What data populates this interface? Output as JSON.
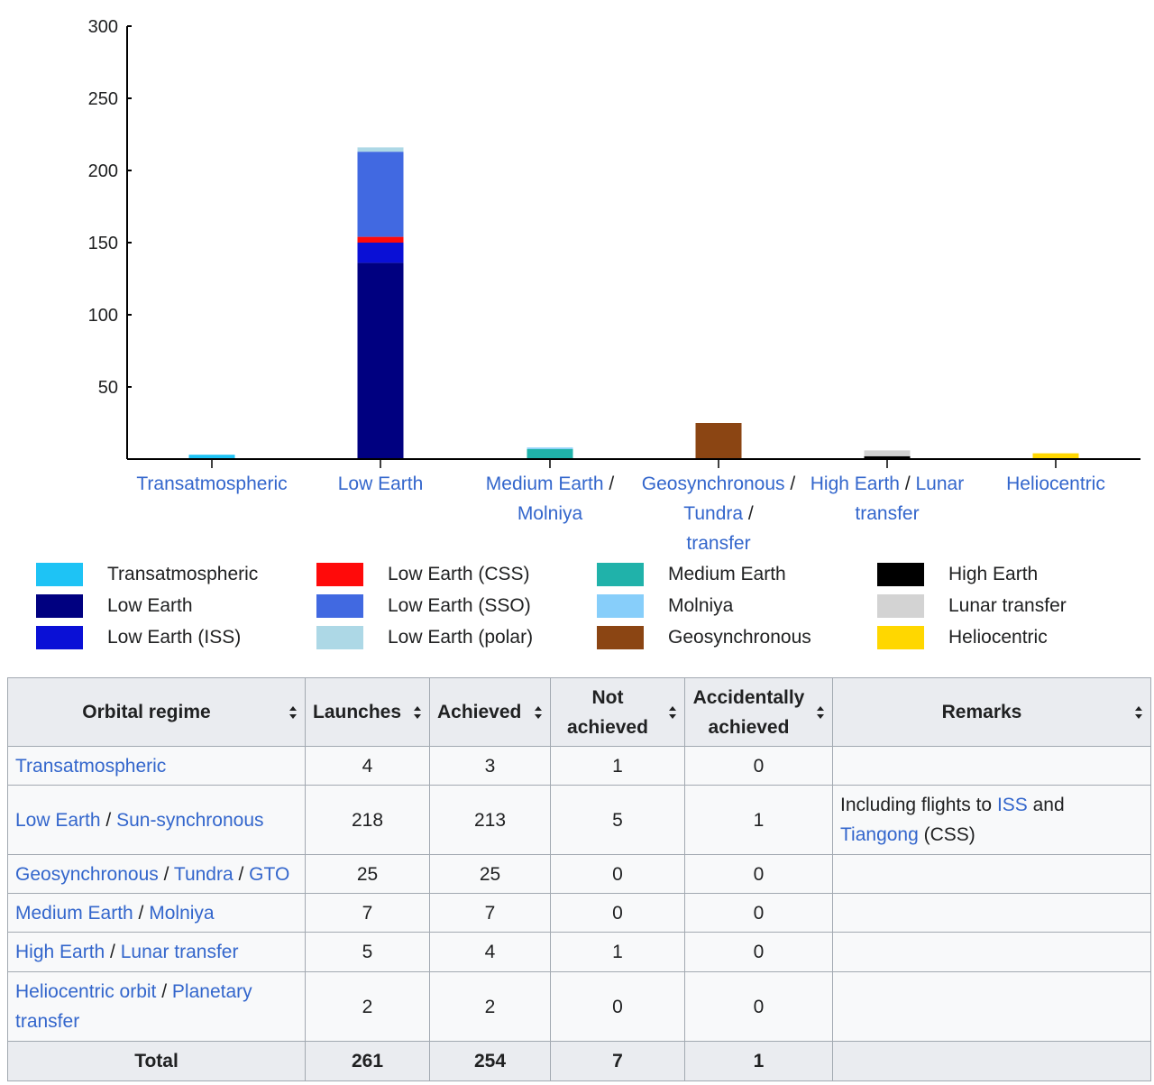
{
  "chart_data": {
    "type": "bar",
    "stacked": true,
    "yticks": [
      50,
      100,
      150,
      200,
      250,
      300
    ],
    "ylim": [
      0,
      300
    ],
    "grid": false,
    "legend_placement": "bottom",
    "categories": [
      [
        {
          "text": "Transatmospheric",
          "link": true
        }
      ],
      [
        {
          "text": "Low Earth",
          "link": true
        }
      ],
      [
        {
          "text": "Medium Earth",
          "link": true
        },
        {
          "text": " /",
          "link": false
        },
        {
          "text": "Molniya",
          "link": true
        }
      ],
      [
        {
          "text": "Geosynchronous",
          "link": true
        },
        {
          "text": " /",
          "link": false
        },
        {
          "text": "Tundra",
          "link": true
        },
        {
          "text": " / ",
          "link": false
        },
        {
          "text": "transfer",
          "link": true
        }
      ],
      [
        {
          "text": "High Earth",
          "link": true
        },
        {
          "text": " / ",
          "link": false
        },
        {
          "text": "Lunar",
          "link": true
        },
        {
          "text": "transfer",
          "link": true
        }
      ],
      [
        {
          "text": "Heliocentric",
          "link": true
        }
      ]
    ],
    "series": [
      {
        "name": "Transatmospheric",
        "color": "#1ec3f5",
        "values": [
          3,
          0,
          0,
          0,
          0,
          0
        ]
      },
      {
        "name": "Low Earth",
        "color": "#000080",
        "values": [
          0,
          136,
          0,
          0,
          0,
          0
        ]
      },
      {
        "name": "Low Earth (ISS)",
        "color": "#0a10d6",
        "values": [
          0,
          14,
          0,
          0,
          0,
          0
        ]
      },
      {
        "name": "Low Earth (CSS)",
        "color": "#ff0a0a",
        "values": [
          0,
          4,
          0,
          0,
          0,
          0
        ]
      },
      {
        "name": "Low Earth (SSO)",
        "color": "#4169e1",
        "values": [
          0,
          59,
          0,
          0,
          0,
          0
        ]
      },
      {
        "name": "Low Earth (polar)",
        "color": "#add8e6",
        "values": [
          0,
          3,
          0,
          0,
          0,
          0
        ]
      },
      {
        "name": "Medium Earth",
        "color": "#20b2aa",
        "values": [
          0,
          0,
          7,
          0,
          0,
          0
        ]
      },
      {
        "name": "Molniya",
        "color": "#87cefa",
        "values": [
          0,
          0,
          1,
          0,
          0,
          0
        ]
      },
      {
        "name": "Geosynchronous",
        "color": "#8b4513",
        "values": [
          0,
          0,
          0,
          25,
          0,
          0
        ]
      },
      {
        "name": "High Earth",
        "color": "#000000",
        "values": [
          0,
          0,
          0,
          0,
          2,
          0
        ]
      },
      {
        "name": "Lunar transfer",
        "color": "#d3d3d3",
        "values": [
          0,
          0,
          0,
          0,
          4,
          0
        ]
      },
      {
        "name": "Heliocentric",
        "color": "#ffd700",
        "values": [
          0,
          0,
          0,
          0,
          0,
          4
        ]
      }
    ]
  },
  "legend": [
    [
      "Transatmospheric",
      "Low Earth",
      "Low Earth (ISS)"
    ],
    [
      "Low Earth (CSS)",
      "Low Earth (SSO)",
      "Low Earth (polar)"
    ],
    [
      "Medium Earth",
      "Molniya",
      "Geosynchronous"
    ],
    [
      "High Earth",
      "Lunar transfer",
      "Heliocentric"
    ]
  ],
  "table": {
    "headers": {
      "orbital_regime": "Orbital regime",
      "launches": "Launches",
      "achieved": "Achieved",
      "not_achieved": "Not achieved",
      "accidentally_achieved": "Accidentally achieved",
      "remarks": "Remarks"
    },
    "rows": [
      {
        "regime": [
          {
            "text": "Transatmospheric",
            "link": true
          }
        ],
        "launches": "4",
        "achieved": "3",
        "not_achieved": "1",
        "accidentally": "0",
        "remarks": []
      },
      {
        "regime": [
          {
            "text": "Low Earth",
            "link": true
          },
          {
            "text": " / ",
            "link": false
          },
          {
            "text": "Sun-synchronous",
            "link": true
          }
        ],
        "launches": "218",
        "achieved": "213",
        "not_achieved": "5",
        "accidentally": "1",
        "remarks": [
          {
            "text": "Including flights to ",
            "link": false
          },
          {
            "text": "ISS",
            "link": true
          },
          {
            "text": " and ",
            "link": false
          },
          {
            "text": "Tiangong",
            "link": true
          },
          {
            "text": " (CSS)",
            "link": false
          }
        ]
      },
      {
        "regime": [
          {
            "text": "Geosynchronous",
            "link": true
          },
          {
            "text": " / ",
            "link": false
          },
          {
            "text": "Tundra",
            "link": true
          },
          {
            "text": " / ",
            "link": false
          },
          {
            "text": "GTO",
            "link": true
          }
        ],
        "launches": "25",
        "achieved": "25",
        "not_achieved": "0",
        "accidentally": "0",
        "remarks": []
      },
      {
        "regime": [
          {
            "text": "Medium Earth",
            "link": true
          },
          {
            "text": " / ",
            "link": false
          },
          {
            "text": "Molniya",
            "link": true
          }
        ],
        "launches": "7",
        "achieved": "7",
        "not_achieved": "0",
        "accidentally": "0",
        "remarks": []
      },
      {
        "regime": [
          {
            "text": "High Earth",
            "link": true
          },
          {
            "text": " / ",
            "link": false
          },
          {
            "text": "Lunar transfer",
            "link": true
          }
        ],
        "launches": "5",
        "achieved": "4",
        "not_achieved": "1",
        "accidentally": "0",
        "remarks": []
      },
      {
        "regime": [
          {
            "text": "Heliocentric orbit",
            "link": true
          },
          {
            "text": " / ",
            "link": false
          },
          {
            "text": "Planetary transfer",
            "link": true
          }
        ],
        "launches": "2",
        "achieved": "2",
        "not_achieved": "0",
        "accidentally": "0",
        "remarks": []
      }
    ],
    "total": {
      "label": "Total",
      "launches": "261",
      "achieved": "254",
      "not_achieved": "7",
      "accidentally": "1",
      "remarks": ""
    }
  }
}
